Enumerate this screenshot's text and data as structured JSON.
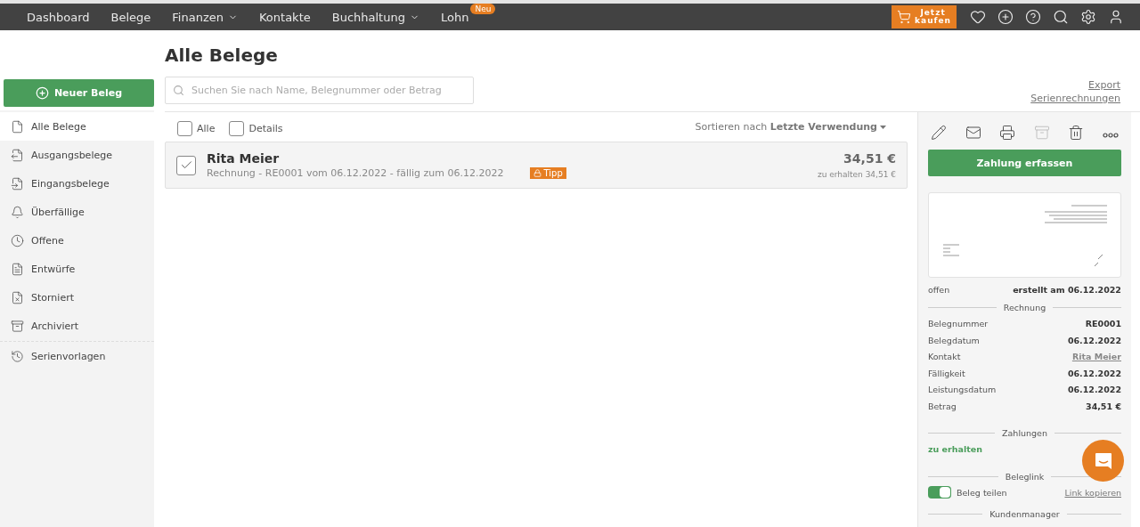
{
  "nav": {
    "items": [
      {
        "label": "Dashboard",
        "dropdown": false
      },
      {
        "label": "Belege",
        "dropdown": false
      },
      {
        "label": "Finanzen",
        "dropdown": true
      },
      {
        "label": "Kontakte",
        "dropdown": false
      },
      {
        "label": "Buchhaltung",
        "dropdown": true
      },
      {
        "label": "Lohn",
        "dropdown": false,
        "badge": "Neu"
      }
    ],
    "buy_button": {
      "line1": "Jetzt",
      "line2": "kaufen"
    },
    "icons": [
      {
        "kind": "favorites"
      },
      {
        "kind": "add"
      },
      {
        "kind": "help"
      },
      {
        "kind": "search"
      },
      {
        "kind": "settings"
      },
      {
        "kind": "account"
      }
    ]
  },
  "sidebar": {
    "new_button": "Neuer Beleg",
    "items": [
      {
        "kind": "all",
        "label": "Alle Belege",
        "selected": true
      },
      {
        "kind": "outgoing",
        "label": "Ausgangsbelege",
        "selected": false
      },
      {
        "kind": "incoming",
        "label": "Eingangsbelege",
        "selected": false
      },
      {
        "kind": "overdue",
        "label": "Überfällige",
        "selected": false
      },
      {
        "kind": "open",
        "label": "Offene",
        "selected": false
      },
      {
        "kind": "drafts",
        "label": "Entwürfe",
        "selected": false
      },
      {
        "kind": "cancelled",
        "label": "Storniert",
        "selected": false
      },
      {
        "kind": "archived",
        "label": "Archiviert",
        "selected": false
      }
    ],
    "extra_items": [
      {
        "kind": "recurring",
        "label": "Serienvorlagen",
        "selected": false
      }
    ]
  },
  "main": {
    "title": "Alle Belege",
    "search": {
      "placeholder": "Suchen Sie nach Name, Belegnummer oder Betrag"
    },
    "links": [
      "Export",
      "Serienrechnungen"
    ],
    "filters": [
      {
        "label": "Alle",
        "checked": false
      },
      {
        "label": "Details",
        "checked": false
      }
    ],
    "sort": {
      "prefix": "Sortieren nach",
      "value": "Letzte Verwendung"
    },
    "documents": [
      {
        "name": "Rita Meier",
        "details": "Rechnung - RE0001 vom 06.12.2022 - fällig zum 06.12.2022",
        "badge": "Tipp",
        "amount": "34,51 €",
        "due": "zu erhalten 34,51 €",
        "checked": true
      }
    ]
  },
  "detail": {
    "actions": [
      {
        "kind": "edit",
        "disabled": false
      },
      {
        "kind": "mail",
        "disabled": false
      },
      {
        "kind": "print",
        "disabled": false
      },
      {
        "kind": "archive",
        "disabled": true
      },
      {
        "kind": "delete",
        "disabled": false
      },
      {
        "kind": "more",
        "disabled": false
      }
    ],
    "primary_button": "Zahlung erfassen",
    "status": "offen",
    "created": "erstellt am 06.12.2022",
    "section_title": "Rechnung",
    "fields": [
      {
        "label": "Belegnummer",
        "value": "RE0001",
        "link": false
      },
      {
        "label": "Belegdatum",
        "value": "06.12.2022",
        "link": false
      },
      {
        "label": "Kontakt",
        "value": "Rita Meier",
        "link": true
      },
      {
        "label": "Fälligkeit",
        "value": "06.12.2022",
        "link": false
      },
      {
        "label": "Leistungsdatum",
        "value": "06.12.2022",
        "link": false
      },
      {
        "label": "Betrag",
        "value": "34,51 €",
        "link": false
      }
    ],
    "payments_title": "Zahlungen",
    "payment_status": "zu erhalten",
    "link_title": "Beleglink",
    "share": {
      "label": "Beleg teilen",
      "on": true
    },
    "copy_link": "Link kopieren",
    "next_section": "Kundenmanager"
  }
}
